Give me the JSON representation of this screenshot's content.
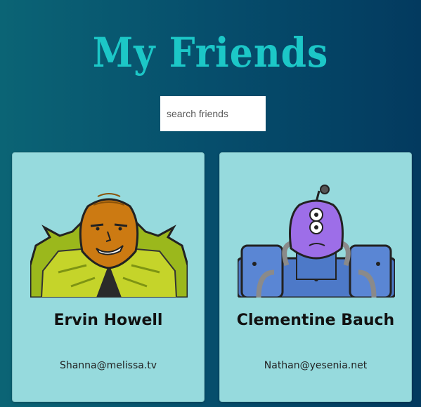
{
  "header": {
    "title": "My Friends"
  },
  "search": {
    "placeholder": "search friends",
    "value": ""
  },
  "friends": [
    {
      "name": "Ervin Howell",
      "email": "Shanna@melissa.tv",
      "avatar_icon": "robot-avatar-orange-icon"
    },
    {
      "name": "Clementine Bauch",
      "email": "Nathan@yesenia.net",
      "avatar_icon": "robot-avatar-purple-icon"
    }
  ],
  "colors": {
    "background_start": "#0b6475",
    "background_end": "#033a5f",
    "title": "#1cc7c7",
    "card": "#96dadd"
  }
}
